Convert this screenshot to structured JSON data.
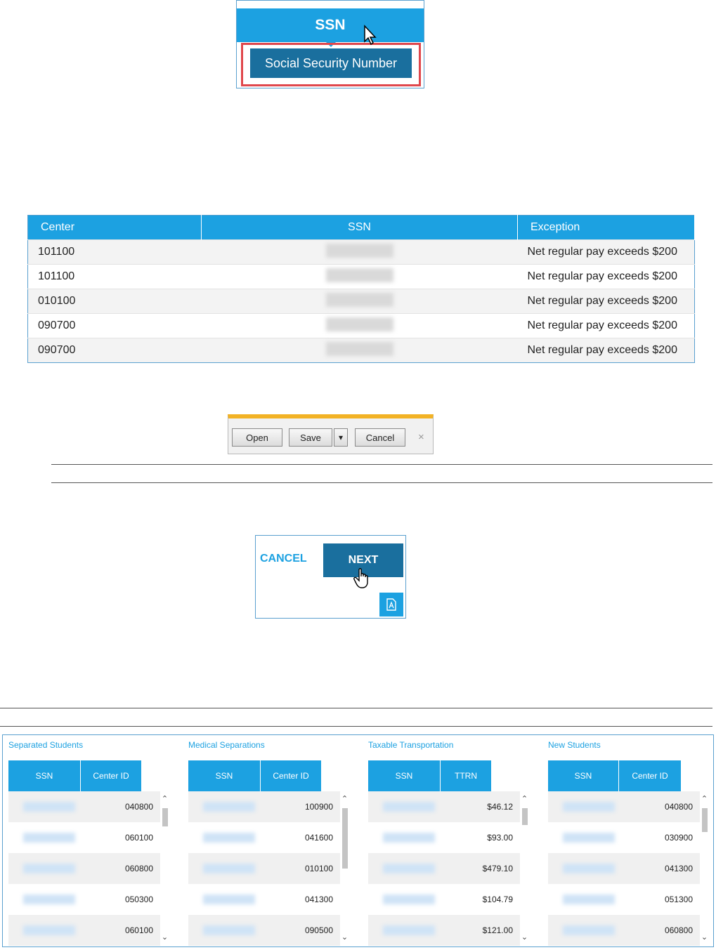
{
  "tooltip": {
    "header": "SSN",
    "tip": "Social Security Number"
  },
  "exceptions": {
    "headers": [
      "Center",
      "SSN",
      "Exception"
    ],
    "rows": [
      {
        "center": "101100",
        "exception": "Net regular pay exceeds $200"
      },
      {
        "center": "101100",
        "exception": "Net regular pay exceeds $200"
      },
      {
        "center": "010100",
        "exception": "Net regular pay exceeds $200"
      },
      {
        "center": "090700",
        "exception": "Net regular pay exceeds $200"
      },
      {
        "center": "090700",
        "exception": "Net regular pay exceeds $200"
      }
    ]
  },
  "download": {
    "open": "Open",
    "save": "Save",
    "dropdown": "▾",
    "cancel": "Cancel",
    "close": "×"
  },
  "actions": {
    "cancel": "CANCEL",
    "next": "NEXT"
  },
  "panels": [
    {
      "title": "Separated Students",
      "col1": "SSN",
      "col2": "Center ID",
      "values": [
        "040800",
        "060100",
        "060800",
        "050300",
        "060100"
      ]
    },
    {
      "title": "Medical Separations",
      "col1": "SSN",
      "col2": "Center ID",
      "values": [
        "100900",
        "041600",
        "010100",
        "041300",
        "090500"
      ]
    },
    {
      "title": "Taxable Transportation",
      "col1": "SSN",
      "col2": "TTRN",
      "values": [
        "$46.12",
        "$93.00",
        "$479.10",
        "$104.79",
        "$121.00"
      ]
    },
    {
      "title": "New Students",
      "col1": "SSN",
      "col2": "Center ID",
      "values": [
        "040800",
        "030900",
        "041300",
        "051300",
        "060800"
      ]
    }
  ],
  "icons": {
    "cursor": "arrow-cursor-icon",
    "hand": "hand-pointer-icon",
    "pdf": "pdf-icon"
  },
  "colors": {
    "accent": "#1ca1e1",
    "dark_accent": "#1a6f9e",
    "highlight": "#e0474c",
    "download_bar": "#f2b225"
  }
}
